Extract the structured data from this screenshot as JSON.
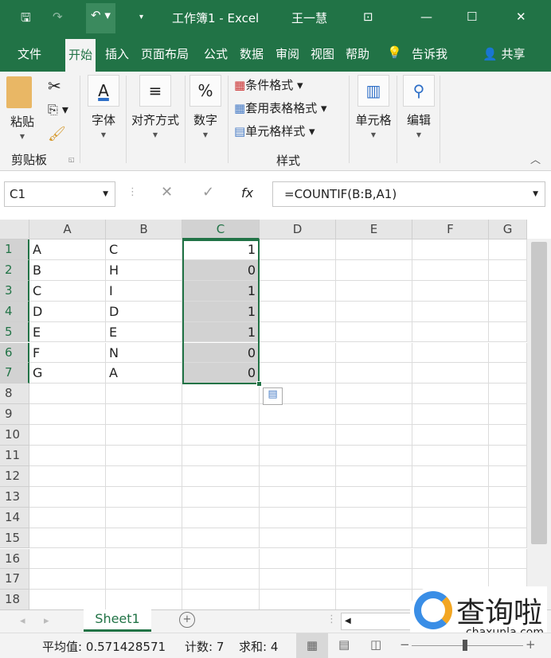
{
  "titlebar": {
    "title": "工作簿1 - Excel",
    "user": "王一慧"
  },
  "tabs": [
    "文件",
    "开始",
    "插入",
    "页面布局",
    "公式",
    "数据",
    "审阅",
    "视图",
    "帮助"
  ],
  "active_tab": "开始",
  "tell_me": "告诉我",
  "share": "共享",
  "ribbon": {
    "paste": "粘贴",
    "clipboard": "剪贴板",
    "font": "字体",
    "align": "对齐方式",
    "number": "数字",
    "cond_format": "条件格式",
    "table_format": "套用表格格式",
    "cell_styles": "单元格样式",
    "styles": "样式",
    "cells": "单元格",
    "edit": "编辑"
  },
  "formula_bar": {
    "name_box": "C1",
    "formula": "=COUNTIF(B:B,A1)",
    "fx": "fx"
  },
  "columns": [
    "A",
    "B",
    "C",
    "D",
    "E",
    "F",
    "G"
  ],
  "rows": [
    "1",
    "2",
    "3",
    "4",
    "5",
    "6",
    "7",
    "8",
    "9",
    "10",
    "11",
    "12",
    "13",
    "14",
    "15",
    "16",
    "17",
    "18"
  ],
  "cells": [
    [
      "A",
      "C",
      "1"
    ],
    [
      "B",
      "H",
      "0"
    ],
    [
      "C",
      "I",
      "1"
    ],
    [
      "D",
      "D",
      "1"
    ],
    [
      "E",
      "E",
      "1"
    ],
    [
      "F",
      "N",
      "0"
    ],
    [
      "G",
      "A",
      "0"
    ]
  ],
  "selection": "C1:C7",
  "sheet_tab": "Sheet1",
  "status": {
    "average": "平均值: 0.571428571",
    "count": "计数: 7",
    "sum": "求和: 4"
  },
  "watermark": {
    "text": "查询啦",
    "url": "chaxunla.com"
  },
  "colors": {
    "brand": "#217346",
    "selection_fill": "#d2d2d2"
  }
}
